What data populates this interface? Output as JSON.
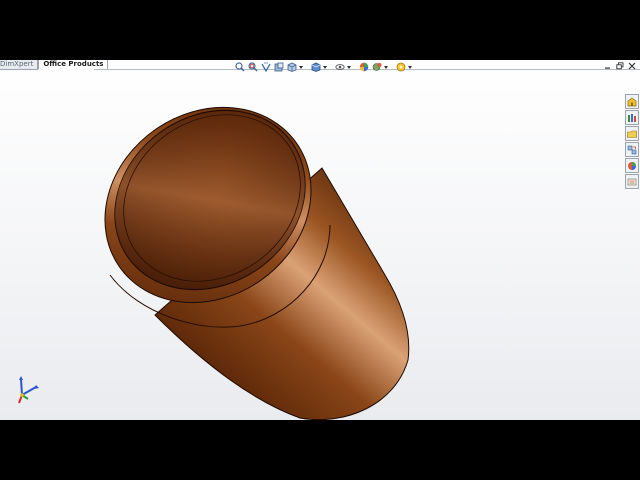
{
  "tabs": [
    {
      "label": "DimXpert",
      "active": false
    },
    {
      "label": "Office Products",
      "active": true
    }
  ],
  "hud_icons": [
    "zoom-to-fit-icon",
    "zoom-to-area-icon",
    "previous-view-icon",
    "section-view-icon",
    "view-orientation-icon",
    "display-style-icon",
    "hide-show-items-icon",
    "edit-appearance-icon",
    "apply-scene-icon",
    "view-settings-icon"
  ],
  "window_controls": [
    "minimize-icon",
    "restore-icon",
    "close-icon"
  ],
  "taskpane_icons": [
    "solidworks-resources-icon",
    "design-library-icon",
    "file-explorer-icon",
    "view-palette-icon",
    "appearances-scenes-icon",
    "custom-properties-icon"
  ],
  "colors": {
    "model_copper_dark": "#4a1f06",
    "model_copper_mid": "#8c4a1c",
    "model_copper_light": "#d9a074",
    "viewport_bg": "#f3f4f6"
  }
}
